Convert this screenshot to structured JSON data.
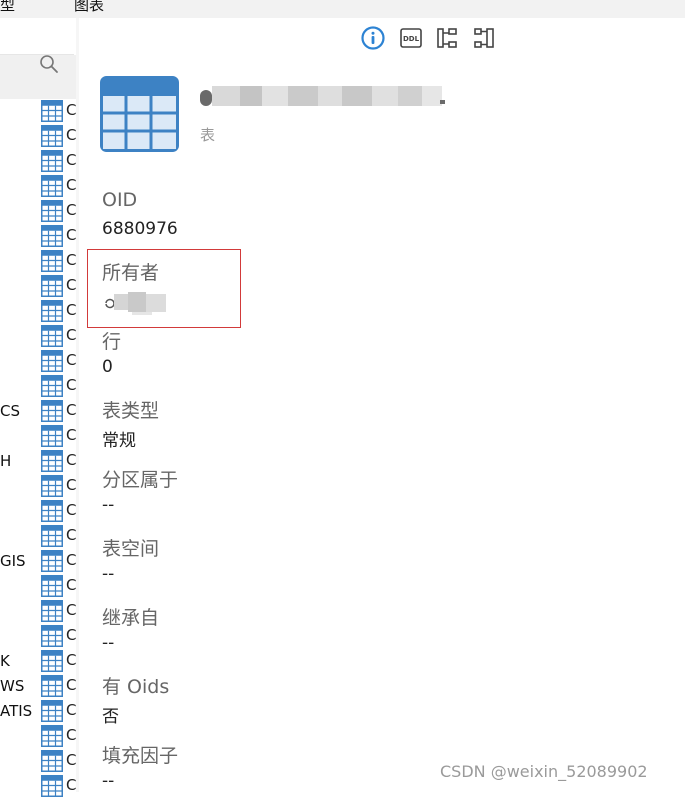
{
  "menu": {
    "left_label": "型",
    "right_label": "图表"
  },
  "tree": {
    "row_letter": "C",
    "row_count": 28,
    "partial_labels": [
      "CS",
      "H",
      "GIS",
      "K",
      "WS",
      "ATIS"
    ]
  },
  "toolbar": {
    "icons": [
      "info-icon",
      "ddl-icon",
      "er-diagram-icon",
      "dependency-icon"
    ],
    "ddl_text": "DDL"
  },
  "object": {
    "type_label": "表"
  },
  "properties": [
    {
      "label": "OID",
      "value": "6880976"
    },
    {
      "label": "所有者",
      "value": ""
    },
    {
      "label": "行",
      "value": "0"
    },
    {
      "label": "表类型",
      "value": "常规"
    },
    {
      "label": "分区属于",
      "value": "--"
    },
    {
      "label": "表空间",
      "value": "--"
    },
    {
      "label": "继承自",
      "value": "--"
    },
    {
      "label": "有 Oids",
      "value": "否"
    },
    {
      "label": "填充因子",
      "value": "--"
    }
  ],
  "watermark": "CSDN @weixin_52089902",
  "colors": {
    "accent": "#2d83d3",
    "table_icon": "#3d82c4",
    "highlight": "#d23a3a"
  }
}
